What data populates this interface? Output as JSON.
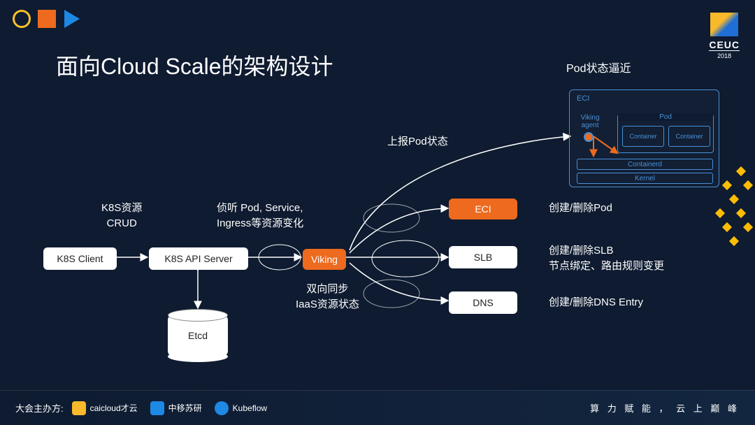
{
  "meta": {
    "logo_name": "CEUC",
    "logo_year": "2018"
  },
  "title": "面向Cloud Scale的架构设计",
  "nodes": {
    "k8s_client": "K8S Client",
    "k8s_api": "K8S API Server",
    "etcd": "Etcd",
    "viking": "Viking",
    "eci": "ECI",
    "slb": "SLB",
    "dns": "DNS"
  },
  "labels": {
    "crud": "K8S资源\nCRUD",
    "listen": "侦听 Pod, Service,\nIngress等资源变化",
    "report": "上报Pod状态",
    "sync": "双向同步\nIaaS资源状态",
    "eci_op": "创建/删除Pod",
    "slb_op": "创建/删除SLB\n节点绑定、路由规则变更",
    "dns_op": "创建/删除DNS Entry",
    "pod_approach": "Pod状态逼近"
  },
  "eci_panel": {
    "title": "ECI",
    "viking_agent": "Viking agent",
    "pod": "Pod",
    "container": "Container",
    "containerd": "Containerd",
    "kernel": "Kernel"
  },
  "footer": {
    "host_label": "大会主办方:",
    "sponsors": [
      "caicloud才云",
      "中移苏研",
      "Kubeflow"
    ],
    "tagline": "算 力 赋 能 ， 云 上 巅 峰"
  }
}
